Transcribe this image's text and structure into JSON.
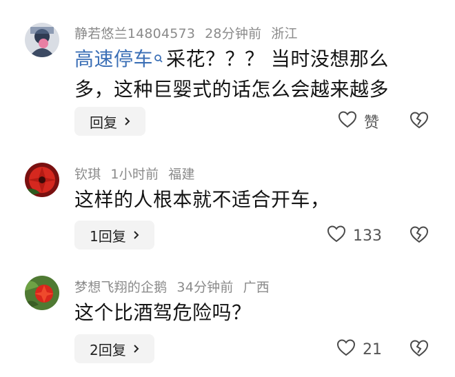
{
  "comments": [
    {
      "username": "静若悠兰14804573",
      "time": "28分钟前",
      "location": "浙江",
      "mention": "高速停车",
      "text": "采花？？？ 当时没想那么多，这种巨婴式的话怎么会越来越多",
      "reply_label": "回复",
      "like_label": "赞",
      "avatar_icon": "avatar-icon"
    },
    {
      "username": "钦琪",
      "time": "1小时前",
      "location": "福建",
      "text": "这样的人根本就不适合开车，",
      "reply_label": "1回复",
      "like_label": "133",
      "avatar_icon": "avatar-icon"
    },
    {
      "username": "梦想飞翔的企鹅",
      "time": "34分钟前",
      "location": "广西",
      "text": "这个比酒驾危险吗？",
      "reply_label": "2回复",
      "like_label": "21",
      "avatar_icon": "avatar-icon"
    }
  ],
  "colors": {
    "mention": "#3b6fb6",
    "meta": "#8a8a8a",
    "reply_bg": "#f3f3f3"
  },
  "icons": [
    "heart-icon",
    "broken-heart-icon",
    "chevron-right-icon",
    "search-icon"
  ]
}
